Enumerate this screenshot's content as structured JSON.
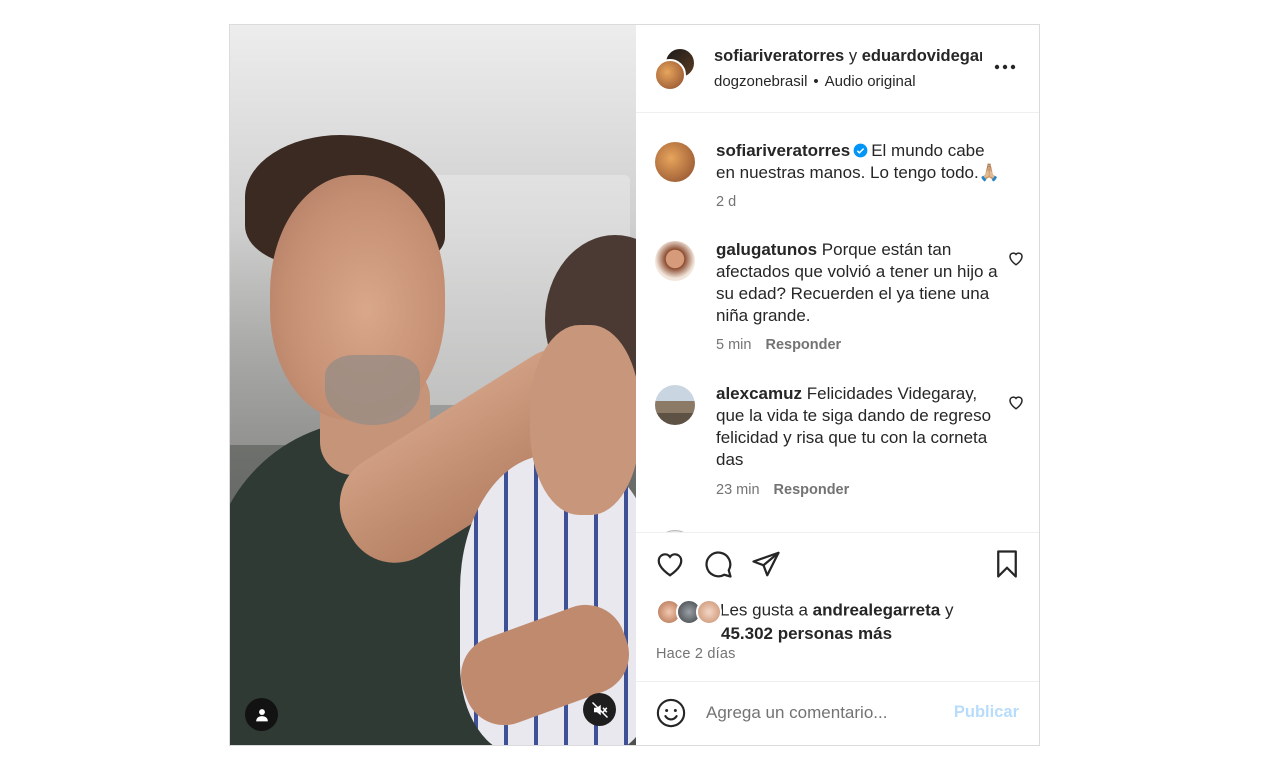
{
  "header": {
    "user1": "sofiariveratorres",
    "joiner": "y",
    "user2": "eduardovidegaray",
    "account": "dogzonebrasil",
    "dot": "•",
    "audio": "Audio original"
  },
  "caption": {
    "username": "sofiariveratorres",
    "text": "El mundo cabe en nuestras manos. Lo tengo todo.🙏🏼",
    "time": "2 d"
  },
  "comments": [
    {
      "username": "galugatunos",
      "text": "Porque están tan afectados que volvió a tener un hijo a su edad? Recuerden el ya tiene una niña grande.",
      "time": "5 min",
      "reply": "Responder"
    },
    {
      "username": "alexcamuz",
      "text": "Felicidades Videgaray, que la vida te siga dando de regreso felicidad y risa que tu con la corneta das",
      "time": "23 min",
      "reply": "Responder"
    }
  ],
  "likes": {
    "prefix": "Les gusta a",
    "user": "andrealegarreta",
    "joiner": "y",
    "others": "45.302 personas más"
  },
  "posted": "Hace 2 días",
  "add_comment": {
    "placeholder": "Agrega un comentario...",
    "publish": "Publicar"
  },
  "colors": {
    "verified": "#0095f6",
    "publish_disabled": "#b8dcfb",
    "secondary_text": "#737373",
    "border": "#dbdbdb"
  },
  "icons": [
    "user-tag-icon",
    "mute-icon",
    "more-icon",
    "verified-icon",
    "heart-icon",
    "comment-icon",
    "share-icon",
    "bookmark-icon",
    "emoji-icon"
  ]
}
